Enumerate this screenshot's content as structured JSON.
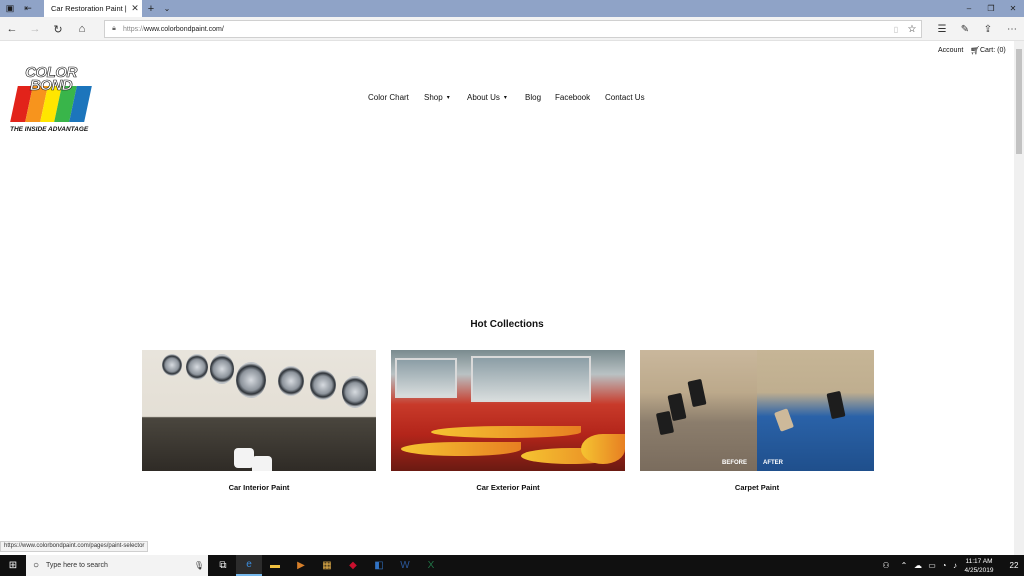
{
  "browser": {
    "tab_title": "Car Restoration Paint | I",
    "url_protocol": "https://",
    "url_host": "www.colorbondpaint.com/",
    "status_url": "https://www.colorbondpaint.com/pages/paint-selector"
  },
  "header": {
    "account_label": "Account",
    "cart_label": "Cart: (0)",
    "logo_text_top": "COLOR",
    "logo_text_bottom": "BOND",
    "logo_tagline": "THE INSIDE ADVANTAGE",
    "logo_colors": [
      "#e2231a",
      "#f7941d",
      "#ffe600",
      "#39b54a",
      "#1c75bc"
    ]
  },
  "nav": {
    "items": [
      {
        "label": "Color Chart",
        "has_dropdown": false
      },
      {
        "label": "Shop",
        "has_dropdown": true
      },
      {
        "label": "About Us",
        "has_dropdown": true
      },
      {
        "label": "Blog",
        "has_dropdown": false
      },
      {
        "label": "Facebook",
        "has_dropdown": false
      },
      {
        "label": "Contact Us",
        "has_dropdown": false
      }
    ]
  },
  "collections": {
    "title": "Hot Collections",
    "items": [
      {
        "label": "Car Interior Paint",
        "image": "car-interior-dashboard-photo"
      },
      {
        "label": "Car Exterior Paint",
        "image": "car-exterior-flames-photo"
      },
      {
        "label": "Carpet Paint",
        "image": "carpet-before-after-photo",
        "before_label": "BEFORE",
        "after_label": "AFTER"
      }
    ]
  },
  "taskbar": {
    "search_placeholder": "Type here to search",
    "time": "11:17 AM",
    "date": "4/25/2019",
    "notification_count": "22"
  },
  "icons": {
    "dropdown": "▾",
    "cart": "shopping-cart-icon"
  }
}
